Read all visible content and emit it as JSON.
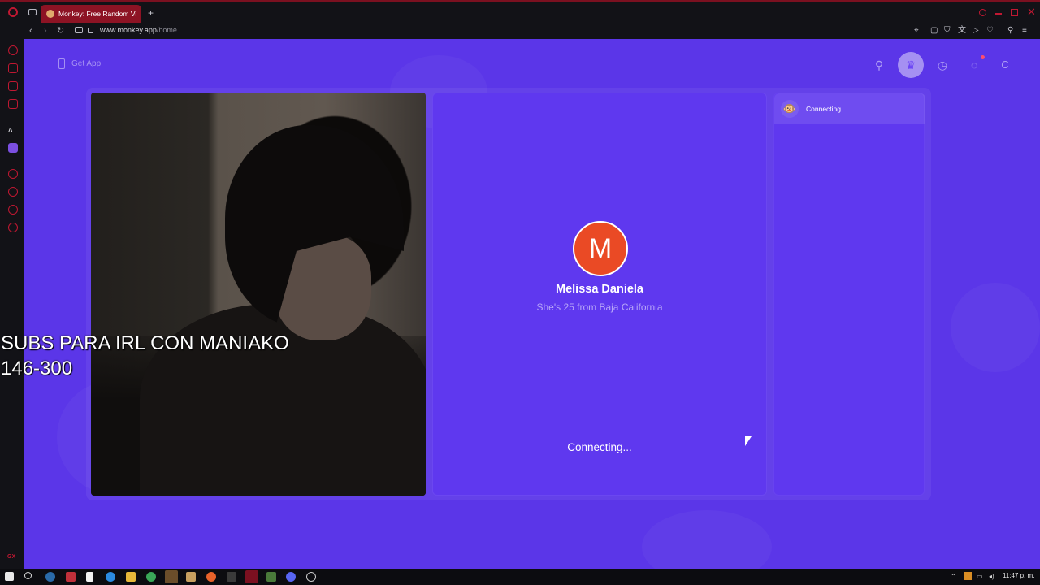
{
  "browser": {
    "tab_title": "Monkey: Free Random Vi",
    "url_host": "www.monkey.app",
    "url_path": "/home",
    "new_tab": "+"
  },
  "header": {
    "get_app_label": "Get App",
    "profile_initial": "C"
  },
  "match": {
    "avatar_letter": "M",
    "name": "Melissa Daniela",
    "info": "She's 25 from Baja California",
    "status": "Connecting..."
  },
  "chat": {
    "status": "Connecting..."
  },
  "overlay": {
    "line1": "SUBS PARA IRL CON MANIAKO",
    "line2": "146-300"
  },
  "taskbar": {
    "time": "11:47 p. m."
  },
  "colors": {
    "page_bg": "#5b36e8",
    "panel_bg": "#5f38ef",
    "avatar_bg": "#ea4a25",
    "browser_accent": "#8d1324"
  }
}
